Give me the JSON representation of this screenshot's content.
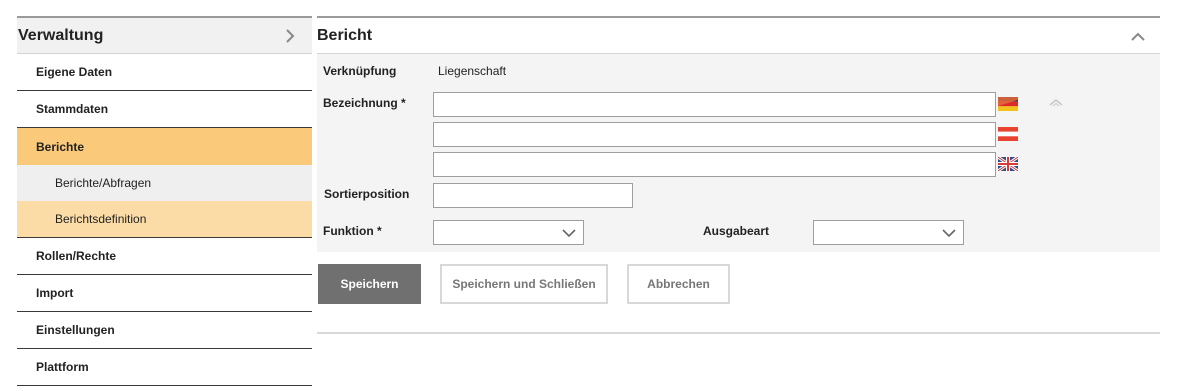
{
  "sidebar": {
    "title": "Verwaltung",
    "items": [
      {
        "label": "Eigene Daten"
      },
      {
        "label": "Stammdaten"
      },
      {
        "label": "Berichte"
      },
      {
        "label": "Berichte/Abfragen"
      },
      {
        "label": "Berichtsdefinition"
      },
      {
        "label": "Rollen/Rechte"
      },
      {
        "label": "Import"
      },
      {
        "label": "Einstellungen"
      },
      {
        "label": "Plattform"
      }
    ]
  },
  "panel": {
    "title": "Bericht",
    "form": {
      "link_label": "Verknüpfung",
      "link_value": "Liegenschaft",
      "name_label": "Bezeichnung *",
      "name_de": "",
      "name_at": "",
      "name_en": "",
      "sort_label": "Sortierposition",
      "sort_value": "",
      "function_label": "Funktion *",
      "function_value": "",
      "output_label": "Ausgabeart",
      "output_value": ""
    },
    "buttons": {
      "save": "Speichern",
      "save_close": "Speichern und Schließen",
      "cancel": "Abbrechen"
    }
  },
  "icons": {
    "sidebar_toggle": "chevron-right-icon",
    "panel_collapse": "chevron-up-icon",
    "dropdown": "chevron-down-icon",
    "flag_de": "flag-germany-icon",
    "flag_at": "flag-austria-icon",
    "flag_en": "flag-uk-icon"
  },
  "colors": {
    "active_item": "#fbc97a",
    "active_subitem": "#fcdca6",
    "primary_button": "#707070"
  }
}
